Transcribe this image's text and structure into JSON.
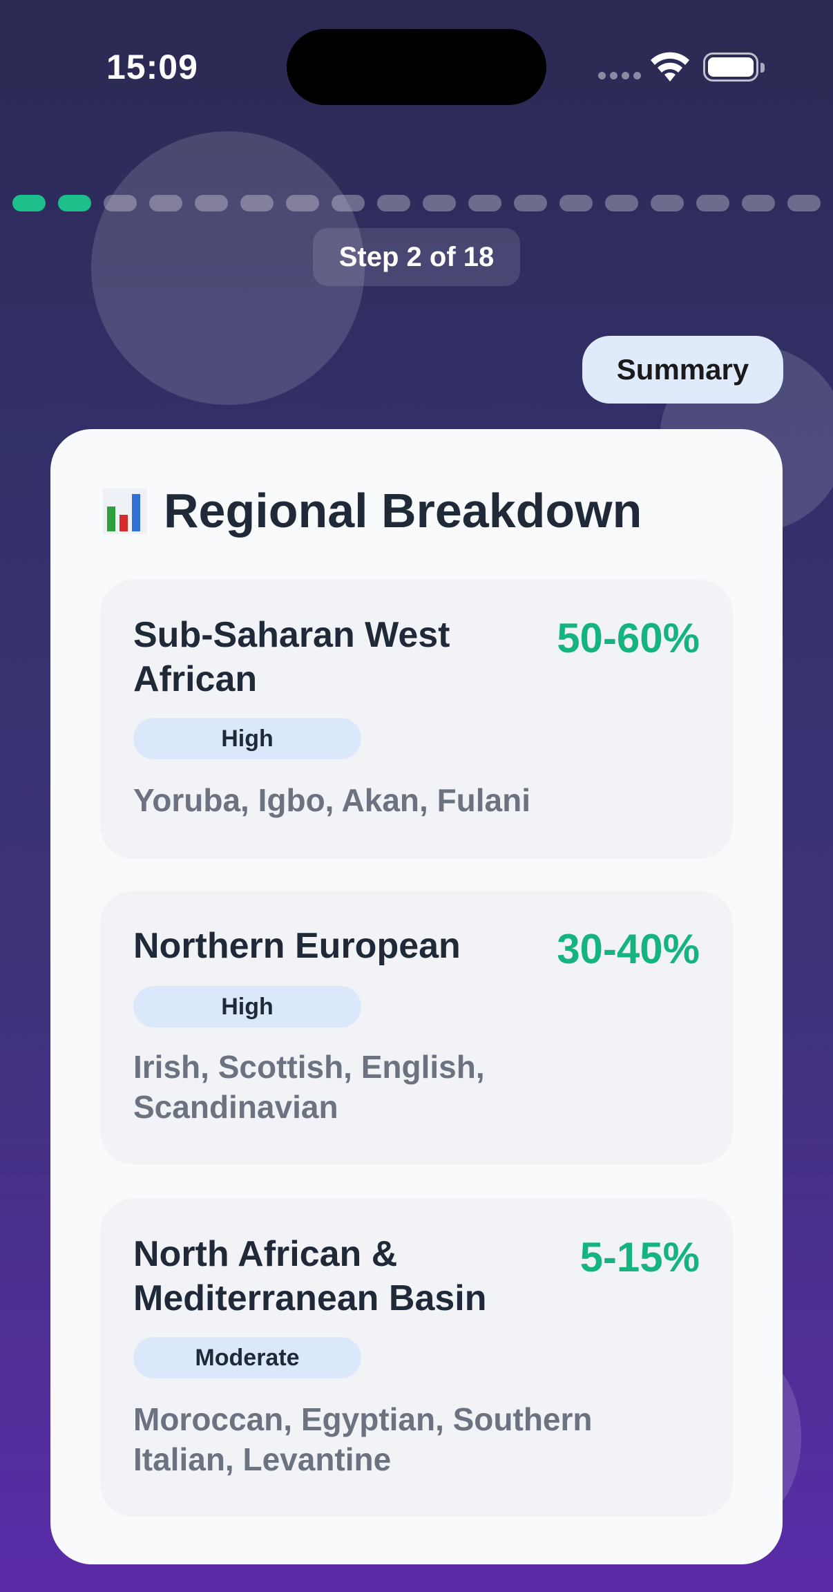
{
  "status_bar": {
    "time": "15:09"
  },
  "progress": {
    "total_steps": 18,
    "completed_steps": 2,
    "step_label": "Step 2 of 18",
    "active_color": "#1dbf8a"
  },
  "summary_button": {
    "label": "Summary"
  },
  "card": {
    "icon": "bar-chart-icon",
    "title": "Regional Breakdown",
    "regions": [
      {
        "name": "Sub-Saharan West African",
        "percentage": "50-60%",
        "confidence": "High",
        "groups": "Yoruba, Igbo, Akan, Fulani"
      },
      {
        "name": "Northern European",
        "percentage": "30-40%",
        "confidence": "High",
        "groups": "Irish, Scottish, English, Scandinavian"
      },
      {
        "name": "North African & Mediterranean Basin",
        "percentage": "5-15%",
        "confidence": "Moderate",
        "groups": "Moroccan, Egyptian, Southern Italian, Levantine"
      }
    ]
  }
}
